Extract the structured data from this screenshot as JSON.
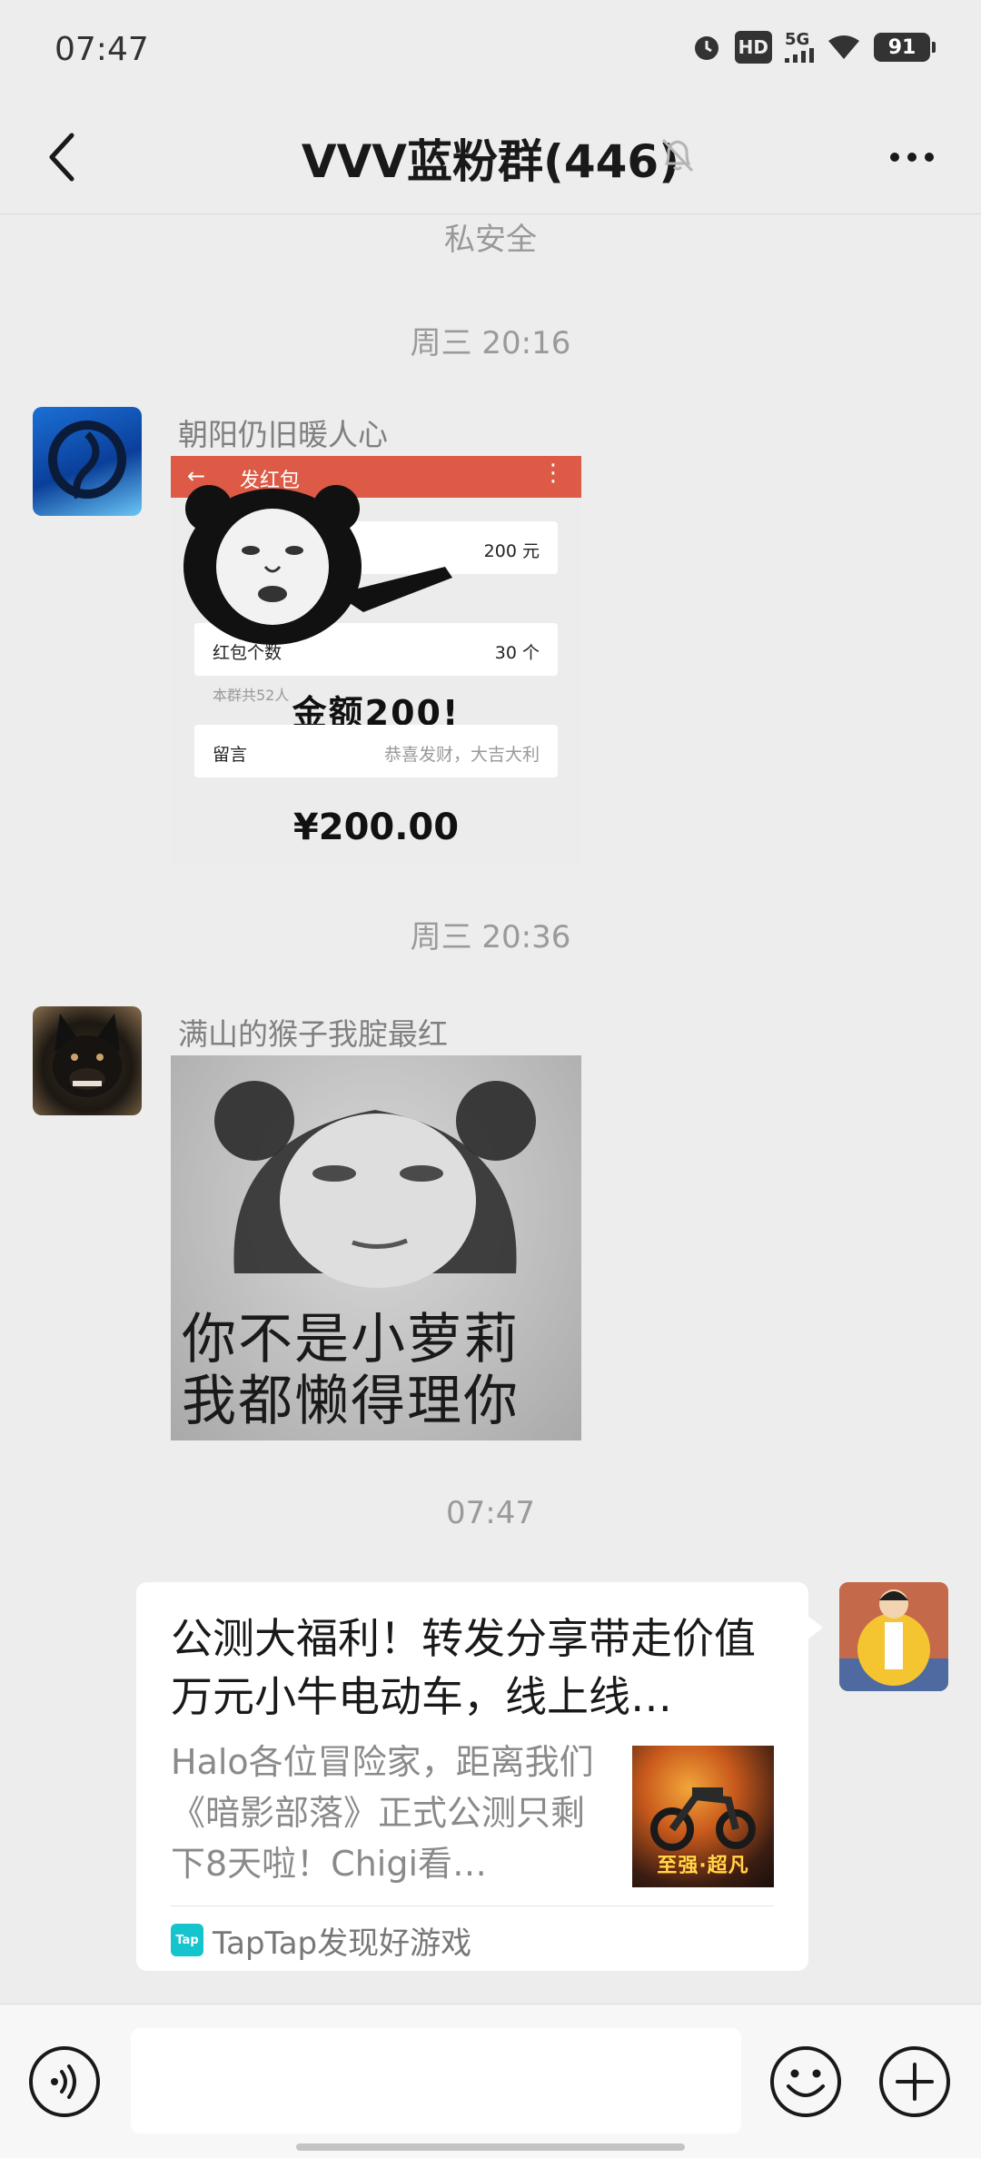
{
  "status_bar": {
    "time": "07:47",
    "hd_label": "HD",
    "network_label": "5G",
    "battery": "91"
  },
  "header": {
    "title": "VVV蓝粉群(446)",
    "muted": true
  },
  "messages": {
    "system_notice": "私安全",
    "time_1": "周三 20:16",
    "msg1": {
      "sender": "朝阳仍旧暖人心",
      "image": {
        "header_title": "发红包",
        "amount_row_value": "200",
        "amount_row_unit": "元",
        "count_label": "红包个数",
        "count_value": "30",
        "count_unit": "个",
        "group_hint": "本群共52人",
        "caption": "金额200!",
        "remark_label": "留言",
        "remark_value": "恭喜发财，大吉大利",
        "total": "¥200.00"
      }
    },
    "time_2": "周三 20:36",
    "msg2": {
      "sender": "满山的猴子我腚最红",
      "image": {
        "line_1": "你不是小萝莉",
        "line_2": "我都懒得理你"
      }
    },
    "time_3": "07:47",
    "msg3": {
      "link_title": "公测大福利！转发分享带走价值万元小牛电动车，线上线…",
      "link_desc": "Halo各位冒险家，距离我们《暗影部落》正式公测只剩下8天啦！Chigi看…",
      "thumb_text": "至强·超凡",
      "source_logo": "Tap",
      "source_name": "TapTap发现好游戏"
    }
  },
  "input_bar": {
    "value": ""
  },
  "colors": {
    "background": "#ededed",
    "bubble": "#ffffff",
    "red_packet": "#dc5a46",
    "taptap": "#15c5ce"
  }
}
